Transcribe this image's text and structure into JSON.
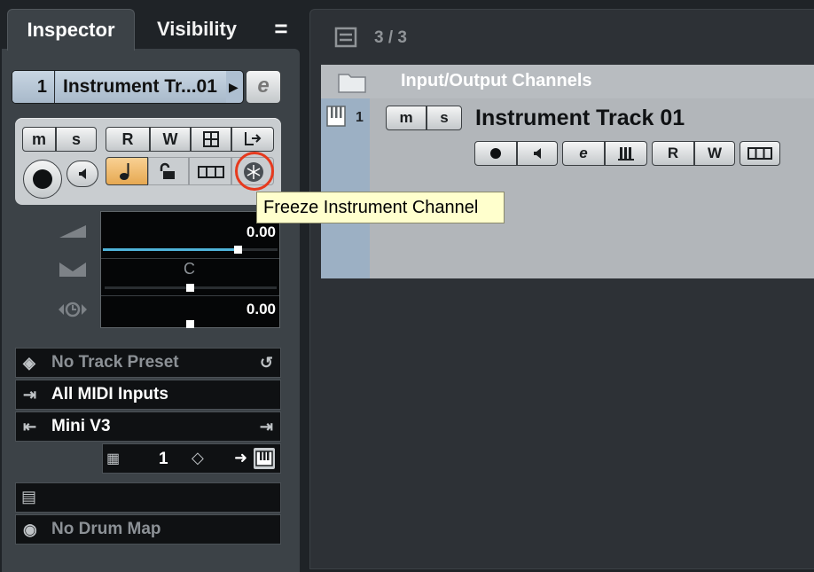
{
  "inspector": {
    "tabs": [
      {
        "label": "Inspector"
      },
      {
        "label": "Visibility"
      }
    ],
    "menu_icon": "=",
    "track": {
      "number": "1",
      "name": "Instrument Tr...01",
      "arrow": "▶",
      "edit_glyph": "e"
    },
    "buttons": {
      "mute": "m",
      "solo": "s",
      "read": "R",
      "write": "W"
    },
    "faders": {
      "volume": "0.00",
      "pan": "C",
      "delay": "0.00"
    },
    "rows": {
      "track_preset": "No Track Preset",
      "midi_input": "All MIDI Inputs",
      "midi_output": "Mini V3",
      "channel": "1",
      "drum_map": "No Drum Map"
    },
    "colors": {
      "accent_blue": "#4fb3d9",
      "freeze_highlight": "#e63a1e",
      "track_color": "#aebfd1"
    }
  },
  "project": {
    "count": "3 / 3",
    "folder_name": "Input/Output Channels",
    "track_number": "1",
    "track_name": "Instrument Track 01",
    "buttons": {
      "mute": "m",
      "solo": "s",
      "read": "R",
      "write": "W",
      "edit_glyph": "e"
    }
  },
  "tooltip": {
    "text": "Freeze Instrument Channel"
  }
}
